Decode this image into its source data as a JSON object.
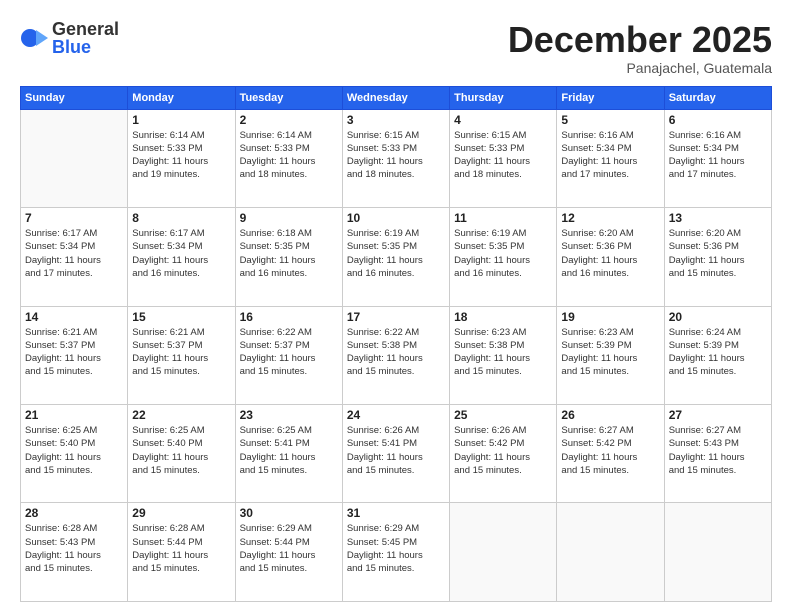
{
  "logo": {
    "general": "General",
    "blue": "Blue"
  },
  "header": {
    "month": "December 2025",
    "location": "Panajachel, Guatemala"
  },
  "weekdays": [
    "Sunday",
    "Monday",
    "Tuesday",
    "Wednesday",
    "Thursday",
    "Friday",
    "Saturday"
  ],
  "weeks": [
    [
      {
        "day": "",
        "info": ""
      },
      {
        "day": "1",
        "info": "Sunrise: 6:14 AM\nSunset: 5:33 PM\nDaylight: 11 hours\nand 19 minutes."
      },
      {
        "day": "2",
        "info": "Sunrise: 6:14 AM\nSunset: 5:33 PM\nDaylight: 11 hours\nand 18 minutes."
      },
      {
        "day": "3",
        "info": "Sunrise: 6:15 AM\nSunset: 5:33 PM\nDaylight: 11 hours\nand 18 minutes."
      },
      {
        "day": "4",
        "info": "Sunrise: 6:15 AM\nSunset: 5:33 PM\nDaylight: 11 hours\nand 18 minutes."
      },
      {
        "day": "5",
        "info": "Sunrise: 6:16 AM\nSunset: 5:34 PM\nDaylight: 11 hours\nand 17 minutes."
      },
      {
        "day": "6",
        "info": "Sunrise: 6:16 AM\nSunset: 5:34 PM\nDaylight: 11 hours\nand 17 minutes."
      }
    ],
    [
      {
        "day": "7",
        "info": "Sunrise: 6:17 AM\nSunset: 5:34 PM\nDaylight: 11 hours\nand 17 minutes."
      },
      {
        "day": "8",
        "info": "Sunrise: 6:17 AM\nSunset: 5:34 PM\nDaylight: 11 hours\nand 16 minutes."
      },
      {
        "day": "9",
        "info": "Sunrise: 6:18 AM\nSunset: 5:35 PM\nDaylight: 11 hours\nand 16 minutes."
      },
      {
        "day": "10",
        "info": "Sunrise: 6:19 AM\nSunset: 5:35 PM\nDaylight: 11 hours\nand 16 minutes."
      },
      {
        "day": "11",
        "info": "Sunrise: 6:19 AM\nSunset: 5:35 PM\nDaylight: 11 hours\nand 16 minutes."
      },
      {
        "day": "12",
        "info": "Sunrise: 6:20 AM\nSunset: 5:36 PM\nDaylight: 11 hours\nand 16 minutes."
      },
      {
        "day": "13",
        "info": "Sunrise: 6:20 AM\nSunset: 5:36 PM\nDaylight: 11 hours\nand 15 minutes."
      }
    ],
    [
      {
        "day": "14",
        "info": "Sunrise: 6:21 AM\nSunset: 5:37 PM\nDaylight: 11 hours\nand 15 minutes."
      },
      {
        "day": "15",
        "info": "Sunrise: 6:21 AM\nSunset: 5:37 PM\nDaylight: 11 hours\nand 15 minutes."
      },
      {
        "day": "16",
        "info": "Sunrise: 6:22 AM\nSunset: 5:37 PM\nDaylight: 11 hours\nand 15 minutes."
      },
      {
        "day": "17",
        "info": "Sunrise: 6:22 AM\nSunset: 5:38 PM\nDaylight: 11 hours\nand 15 minutes."
      },
      {
        "day": "18",
        "info": "Sunrise: 6:23 AM\nSunset: 5:38 PM\nDaylight: 11 hours\nand 15 minutes."
      },
      {
        "day": "19",
        "info": "Sunrise: 6:23 AM\nSunset: 5:39 PM\nDaylight: 11 hours\nand 15 minutes."
      },
      {
        "day": "20",
        "info": "Sunrise: 6:24 AM\nSunset: 5:39 PM\nDaylight: 11 hours\nand 15 minutes."
      }
    ],
    [
      {
        "day": "21",
        "info": "Sunrise: 6:25 AM\nSunset: 5:40 PM\nDaylight: 11 hours\nand 15 minutes."
      },
      {
        "day": "22",
        "info": "Sunrise: 6:25 AM\nSunset: 5:40 PM\nDaylight: 11 hours\nand 15 minutes."
      },
      {
        "day": "23",
        "info": "Sunrise: 6:25 AM\nSunset: 5:41 PM\nDaylight: 11 hours\nand 15 minutes."
      },
      {
        "day": "24",
        "info": "Sunrise: 6:26 AM\nSunset: 5:41 PM\nDaylight: 11 hours\nand 15 minutes."
      },
      {
        "day": "25",
        "info": "Sunrise: 6:26 AM\nSunset: 5:42 PM\nDaylight: 11 hours\nand 15 minutes."
      },
      {
        "day": "26",
        "info": "Sunrise: 6:27 AM\nSunset: 5:42 PM\nDaylight: 11 hours\nand 15 minutes."
      },
      {
        "day": "27",
        "info": "Sunrise: 6:27 AM\nSunset: 5:43 PM\nDaylight: 11 hours\nand 15 minutes."
      }
    ],
    [
      {
        "day": "28",
        "info": "Sunrise: 6:28 AM\nSunset: 5:43 PM\nDaylight: 11 hours\nand 15 minutes."
      },
      {
        "day": "29",
        "info": "Sunrise: 6:28 AM\nSunset: 5:44 PM\nDaylight: 11 hours\nand 15 minutes."
      },
      {
        "day": "30",
        "info": "Sunrise: 6:29 AM\nSunset: 5:44 PM\nDaylight: 11 hours\nand 15 minutes."
      },
      {
        "day": "31",
        "info": "Sunrise: 6:29 AM\nSunset: 5:45 PM\nDaylight: 11 hours\nand 15 minutes."
      },
      {
        "day": "",
        "info": ""
      },
      {
        "day": "",
        "info": ""
      },
      {
        "day": "",
        "info": ""
      }
    ]
  ]
}
